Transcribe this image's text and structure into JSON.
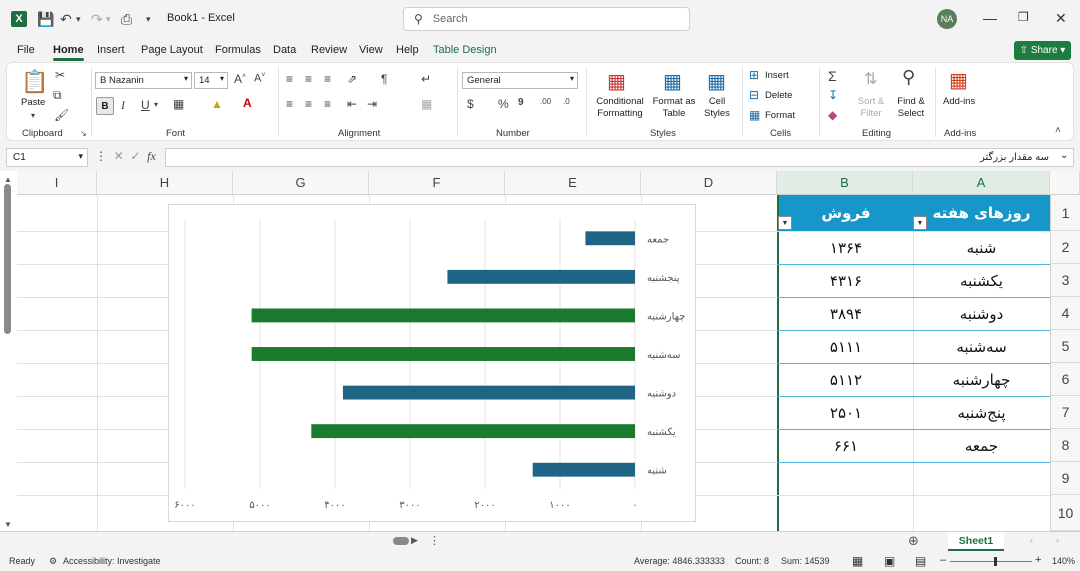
{
  "app": {
    "title": "Book1 - Excel",
    "search_placeholder": "Search",
    "user_initials": "NA",
    "share_label": "Share"
  },
  "menu": [
    "File",
    "Home",
    "Insert",
    "Page Layout",
    "Formulas",
    "Data",
    "Review",
    "View",
    "Help",
    "Table Design"
  ],
  "ribbon": {
    "paste": "Paste",
    "font_name": "B Nazanin",
    "font_size": "14",
    "number_format": "General",
    "conditional_formatting": [
      "Conditional",
      "Formatting"
    ],
    "format_as_table": [
      "Format as",
      "Table"
    ],
    "cell_styles": [
      "Cell",
      "Styles"
    ],
    "insert": "Insert",
    "delete": "Delete",
    "format": "Format",
    "sort_filter": [
      "Sort &",
      "Filter"
    ],
    "find_select": [
      "Find &",
      "Select"
    ],
    "addins": "Add-ins",
    "groups": [
      "Clipboard",
      "Font",
      "Alignment",
      "Number",
      "Styles",
      "Cells",
      "Editing",
      "Add-ins"
    ]
  },
  "formula_bar": {
    "name_box": "C1",
    "content": "سه مقدار بزرگتر"
  },
  "columns": [
    "I",
    "H",
    "G",
    "F",
    "E",
    "D",
    "C",
    "B",
    "A"
  ],
  "rows": [
    "1",
    "2",
    "3",
    "4",
    "5",
    "6",
    "7",
    "8",
    "9",
    "10"
  ],
  "table": {
    "headers": [
      "فروش",
      "روزهای هفته"
    ],
    "rows": [
      {
        "day": "شنبه",
        "sales": "۱۳۶۴"
      },
      {
        "day": "یکشنبه",
        "sales": "۴۳۱۶"
      },
      {
        "day": "دوشنبه",
        "sales": "۳۸۹۴"
      },
      {
        "day": "سه‌شنبه",
        "sales": "۵۱۱۱"
      },
      {
        "day": "چهارشنبه",
        "sales": "۵۱۱۲"
      },
      {
        "day": "پنج‌شنبه",
        "sales": "۲۵۰۱"
      },
      {
        "day": "جمعه",
        "sales": "۶۶۱"
      }
    ]
  },
  "chart_data": {
    "type": "bar",
    "orientation": "horizontal",
    "categories": [
      "جمعه",
      "پنجشنبه",
      "چهارشنبه",
      "سه‌شنبه",
      "دوشنبه",
      "یکشنبه",
      "شنبه"
    ],
    "values": [
      661,
      2501,
      5112,
      5111,
      3894,
      4316,
      1364
    ],
    "highlight": [
      false,
      false,
      true,
      true,
      false,
      true,
      false
    ],
    "colors": {
      "normal": "#1f6485",
      "highlight": "#1a7a2e"
    },
    "xlim": [
      0,
      6000
    ],
    "x_ticks": [
      "۰",
      "۱۰۰۰",
      "۲۰۰۰",
      "۳۰۰۰",
      "۴۰۰۰",
      "۵۰۰۰",
      "۶۰۰۰"
    ],
    "x_reversed": true,
    "grid": true,
    "title": ""
  },
  "sheet_tab": "Sheet1",
  "status": {
    "ready": "Ready",
    "accessibility": "Accessibility: Investigate",
    "average": "Average: 4846.333333",
    "count": "Count: 8",
    "sum": "Sum: 14539",
    "zoom": "140%"
  }
}
